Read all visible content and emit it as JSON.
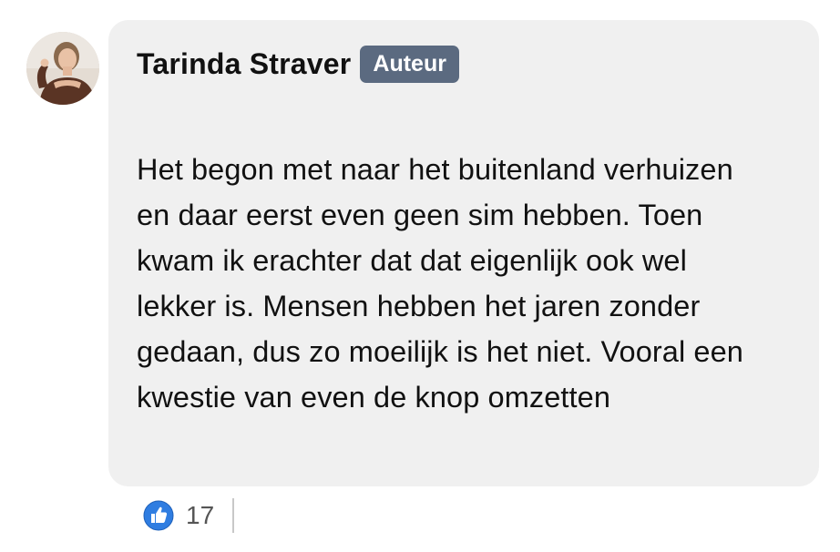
{
  "comment": {
    "author": "Tarinda Straver",
    "badge": "Auteur",
    "text": "Het begon met naar het buitenland verhuizen en daar eerst even geen sim hebben. Toen kwam ik erachter dat dat eigenlijk ook wel lekker is. Mensen hebben het jaren zonder gedaan, dus zo moeilijk is het niet. Vooral een kwestie van even de knop omzetten",
    "avatar_icon": "user-photo",
    "bubble_color": "#f0f0f0",
    "badge_color": "#5b6a80"
  },
  "reactions": {
    "icon": "thumbs-up-icon",
    "icon_color": "#2f7de1",
    "count": "17"
  }
}
